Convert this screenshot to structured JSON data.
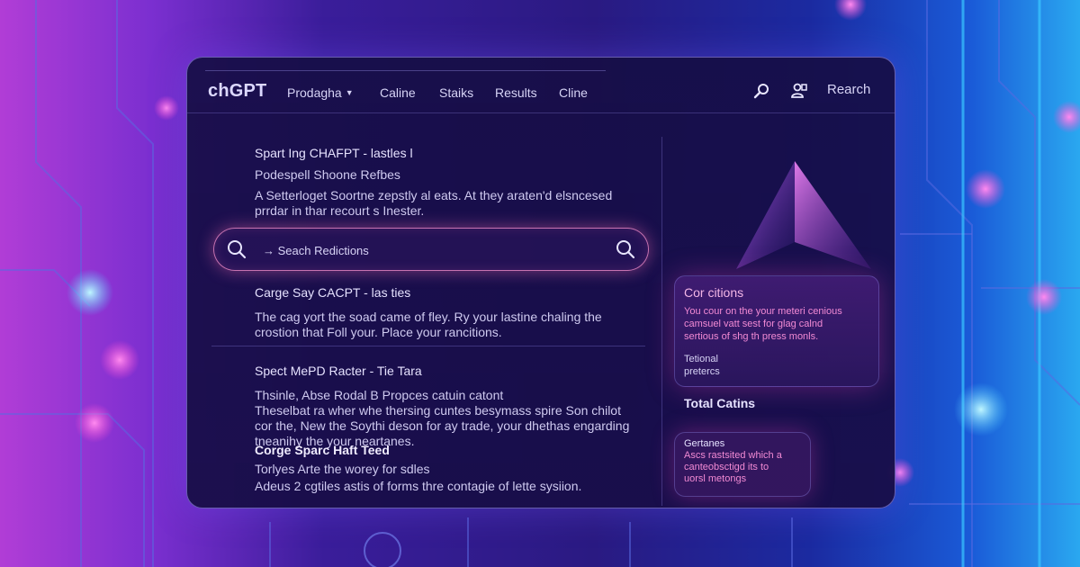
{
  "app": {
    "logo": "chGPT"
  },
  "nav": {
    "items": [
      {
        "label": "Prodagha",
        "dropdown": true
      },
      {
        "label": "Caline"
      },
      {
        "label": "Staiks"
      },
      {
        "label": "Results"
      },
      {
        "label": "Cline"
      }
    ],
    "search_label": "Rearch"
  },
  "icons": [
    "search-icon",
    "user-icon",
    "magnifier-icon"
  ],
  "colors": {
    "accent": "#f07ac8",
    "card_title": "#f3b6e6",
    "window_bg": "#1a0f48",
    "highlight_text": "#f28ad4"
  },
  "main": {
    "section1": {
      "title": "Spart Ing CHAFPT - lastles l",
      "subtitle": "Podespell Shoone Refbes",
      "text1": "A Setterloget Soortne zepstly al eats. At they araten'd elsncesed",
      "text2": "prrdar in thar recourt s Inester."
    },
    "search": {
      "placeholder": "→ Seach Redictions"
    },
    "section2": {
      "title": "Carge Say CACPT - las ties",
      "text1": "The cag yort the soad came of fley. Ry your lastine chaling the",
      "text2": "crostion that Foll your. Place your rancitions."
    },
    "section3": {
      "title": "Spect MePD Racter - Tie Tara",
      "text1": "Thsinle, Abse Rodal B Propces catuin catont",
      "text2": "Theselbat ra wher whe thersing cuntes besymass spire Son chilot",
      "text3": "cor the, New the Soythi deson for ay trade, your dhethas engarding",
      "text4": "tneanihy the your neartanes."
    },
    "section4": {
      "title": "Corge Sparc Haft Teed",
      "text1": "Torlyes Arte the worey for sdles",
      "text2": "Adeus 2 cgtiles astis of forms thre contagie of lette sysiion."
    }
  },
  "sidebar": {
    "card1": {
      "title": "Cor citions",
      "text1": "You cour on the your meteri cenious",
      "text2": "camsuel vatt sest for glag calnd",
      "text3": "sertious of shg th press monls.",
      "footer1": "Tetional",
      "footer2": "pretercs"
    },
    "section_title": "Total Catins",
    "card2": {
      "title": "Gertanes",
      "text1": "Ascs rastsited which a",
      "text2": "canteobsctigd its to",
      "text3": "uorsl metongs"
    }
  }
}
